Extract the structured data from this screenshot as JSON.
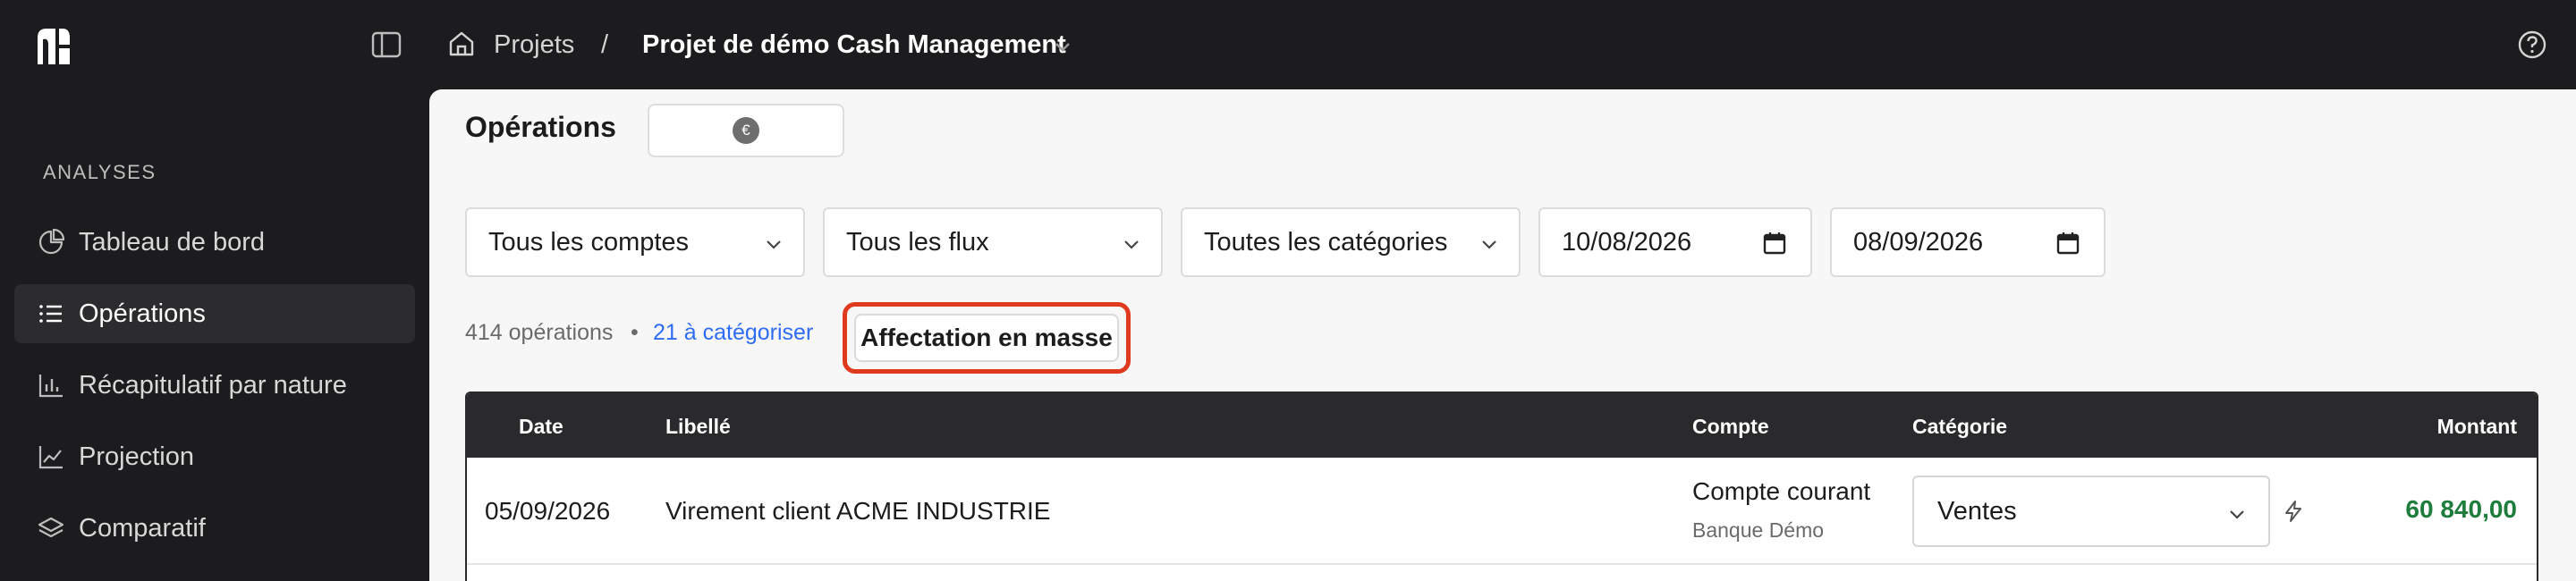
{
  "breadcrumb": {
    "home_label": "Projets",
    "separator": "/",
    "current_project": "Projet de démo Cash Management"
  },
  "sidebar": {
    "section_label": "ANALYSES",
    "items": [
      {
        "label": "Tableau de bord",
        "icon": "pie-chart-icon",
        "active": false
      },
      {
        "label": "Opérations",
        "icon": "list-icon",
        "active": true
      },
      {
        "label": "Récapitulatif par nature",
        "icon": "bar-chart-icon",
        "active": false
      },
      {
        "label": "Projection",
        "icon": "line-chart-icon",
        "active": false
      },
      {
        "label": "Comparatif",
        "icon": "layers-icon",
        "active": false
      }
    ]
  },
  "main": {
    "title": "Opérations",
    "currency_symbol": "€",
    "filters": {
      "accounts": "Tous les comptes",
      "flows": "Tous les flux",
      "categories": "Toutes les catégories",
      "date_from": "10/08/2026",
      "date_to": "08/09/2026"
    },
    "summary": {
      "count_text": "414 opérations",
      "separator": "•",
      "to_categorize": "21 à catégoriser",
      "mass_assign_label": "Affectation en masse"
    },
    "table": {
      "headers": {
        "date": "Date",
        "label": "Libellé",
        "account": "Compte",
        "category": "Catégorie",
        "amount": "Montant"
      },
      "rows": [
        {
          "date": "05/09/2026",
          "label": "Virement client ACME INDUSTRIE",
          "account": "Compte courant",
          "bank": "Banque Démo",
          "category": "Ventes",
          "amount": "60 840,00"
        }
      ]
    }
  },
  "colors": {
    "topbar_bg": "#1c1c1e",
    "highlight_border": "#e03a1e",
    "link_blue": "#2f6cf5",
    "positive_amount": "#1e7d3c"
  }
}
